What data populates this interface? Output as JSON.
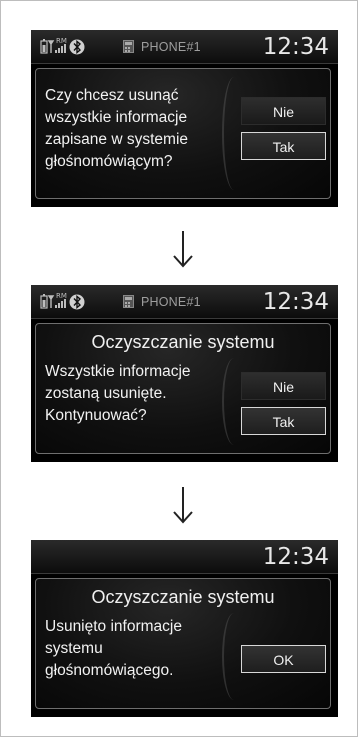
{
  "screens": [
    {
      "status": {
        "phone_label": "PHONE#1",
        "time": "12:34",
        "signal_badge": "RM"
      },
      "dialog": {
        "title": "",
        "message_lines": [
          "Czy chcesz usunąć",
          "wszystkie informacje",
          "zapisane w systemie",
          "głośnomówiącym?"
        ],
        "buttons": [
          "Nie",
          "Tak"
        ]
      }
    },
    {
      "status": {
        "phone_label": "PHONE#1",
        "time": "12:34",
        "signal_badge": "RM"
      },
      "dialog": {
        "title": "Oczyszczanie systemu",
        "message_lines": [
          "Wszystkie informacje",
          "zostaną usunięte.",
          "Kontynuować?"
        ],
        "buttons": [
          "Nie",
          "Tak"
        ]
      }
    },
    {
      "status": {
        "time": "12:34"
      },
      "dialog": {
        "title": "Oczyszczanie systemu",
        "message_lines": [
          "Usunięto informacje",
          "systemu",
          "głośnomówiącego."
        ],
        "buttons": [
          "OK"
        ]
      }
    }
  ]
}
